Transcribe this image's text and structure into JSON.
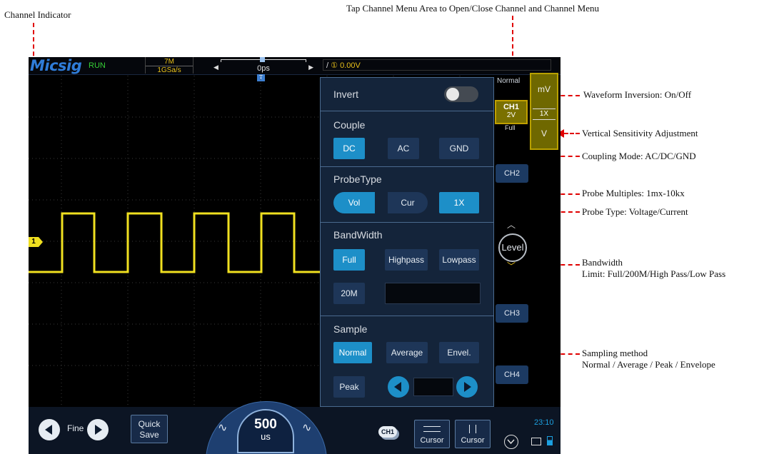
{
  "annotations": {
    "channel_indicator": "Channel Indicator",
    "tap_channel_menu": "Tap Channel Menu Area to Open/Close Channel and Channel Menu",
    "waveform_inversion": "Waveform Inversion: On/Off",
    "vertical_sensitivity": "Vertical Sensitivity Adjustment",
    "coupling_mode": "Coupling Mode: AC/DC/GND",
    "probe_multiples": "Probe Multiples: 1mx-10kx",
    "probe_type": "Probe Type: Voltage/Current",
    "bandwidth_line1": "Bandwidth",
    "bandwidth_line2": "Limit: Full/200M/High Pass/Low Pass",
    "sampling_line1": "Sampling method",
    "sampling_line2": "Normal / Average / Peak / Envelope"
  },
  "topbar": {
    "logo": "Micsig",
    "status": "RUN",
    "memory_depth": "7M",
    "sample_rate": "1GSa/s",
    "time_position": "0ps",
    "trigger_source": "①",
    "trigger_level": "0.00V",
    "trigger_marker": "T"
  },
  "channel_marker": "1",
  "menu": {
    "invert_label": "Invert",
    "invert_on": false,
    "couple_label": "Couple",
    "couple_options": [
      "DC",
      "AC",
      "GND"
    ],
    "couple_selected": "DC",
    "probe_label": "ProbeType",
    "probe_options": [
      "Vol",
      "Cur",
      "1X"
    ],
    "bandwidth_label": "BandWidth",
    "bandwidth_options": [
      "Full",
      "Highpass",
      "Lowpass",
      "20M"
    ],
    "bandwidth_selected": "Full",
    "sample_label": "Sample",
    "sample_options": [
      "Normal",
      "Average",
      "Envel.",
      "Peak"
    ],
    "sample_selected": "Normal"
  },
  "sidebar": {
    "trigger_mode": "Normal",
    "ch1_label": "CH1",
    "ch1_scale": "2V",
    "ch1_bandwidth": "Full",
    "ch2_label": "CH2",
    "ch3_label": "CH3",
    "ch4_label": "CH4",
    "level_label": "Level",
    "sensitivity_up": "mV",
    "probe_factor": "1X",
    "sensitivity_down": "V"
  },
  "bottombar": {
    "fine_label": "Fine",
    "quick_save_line1": "Quick",
    "quick_save_line2": "Save",
    "timebase_value": "500",
    "timebase_unit": "us",
    "ch_select_label": "CH1",
    "cursor_label_1": "Cursor",
    "cursor_label_2": "Cursor",
    "clock": "23:10"
  },
  "colors": {
    "screen_bg": "#000000",
    "menu_bg": "#14243a",
    "selected_button": "#1d8fc8",
    "trace_yellow": "#f0e020",
    "annotation_red": "#e00000",
    "logo_blue": "#2f7cd8"
  },
  "icons": {
    "left_arrow": "left-arrow-icon",
    "right_arrow": "right-arrow-icon",
    "chevron_down": "chevron-down-icon",
    "battery": "battery-icon",
    "monitor": "monitor-icon"
  }
}
